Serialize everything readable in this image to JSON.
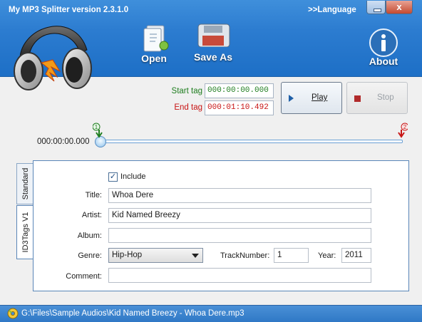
{
  "window": {
    "title": "My MP3 Splitter version 2.3.1.0",
    "language_link": ">>Language",
    "close_glyph": "x"
  },
  "toolbar": {
    "open_label": "Open",
    "save_as_label": "Save As",
    "about_label": "About"
  },
  "tags": {
    "start_label": "Start tag",
    "start_value": "000:00:00.000",
    "end_label": "End tag",
    "end_value": "000:01:10.492"
  },
  "playback": {
    "play_label": "Play",
    "stop_label": "Stop"
  },
  "timeline": {
    "position": "000:00:00.000",
    "start_marker_number": "1",
    "end_marker_number": "2"
  },
  "tag_tabs": [
    "Standard",
    "ID3Tags V1"
  ],
  "id3": {
    "include_label": "Include",
    "include_checked": true,
    "title_label": "Title:",
    "title_value": "Whoa Dere",
    "artist_label": "Artist:",
    "artist_value": "Kid Named Breezy",
    "album_label": "Album:",
    "album_value": "",
    "genre_label": "Genre:",
    "genre_value": "Hip-Hop",
    "track_label": "TrackNumber:",
    "track_value": "1",
    "year_label": "Year:",
    "year_value": "2011",
    "comment_label": "Comment:",
    "comment_value": ""
  },
  "status": {
    "file_path": "G:\\Files\\Sample Audios\\Kid Named Breezy - Whoa Dere.mp3"
  },
  "colors": {
    "header_blue": "#2c7cd0",
    "start_green": "#1e7d1e",
    "end_red": "#c81414"
  },
  "icons": [
    "headphones-logo-icon",
    "open-folder-icon",
    "floppy-disk-icon",
    "info-icon",
    "play-icon",
    "stop-icon",
    "start-marker-icon",
    "end-marker-icon",
    "disc-status-icon"
  ]
}
